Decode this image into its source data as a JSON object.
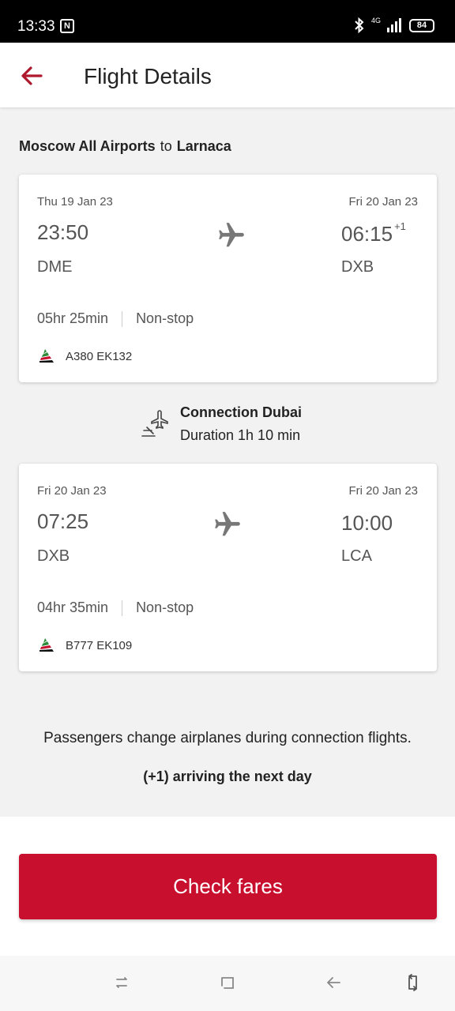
{
  "status": {
    "time": "13:33",
    "nfc": "N",
    "network": "4G",
    "battery": "84"
  },
  "header": {
    "title": "Flight Details"
  },
  "route": {
    "from": "Moscow All Airports",
    "connector": "to",
    "to": "Larnaca"
  },
  "segments": [
    {
      "dep_date": "Thu 19 Jan 23",
      "dep_time": "23:50",
      "dep_code": "DME",
      "arr_date": "Fri 20 Jan 23",
      "arr_time": "06:15",
      "arr_offset": "+1",
      "arr_code": "DXB",
      "duration": "05hr 25min",
      "stops": "Non-stop",
      "flight": "A380 EK132"
    },
    {
      "dep_date": "Fri 20 Jan 23",
      "dep_time": "07:25",
      "dep_code": "DXB",
      "arr_date": "Fri 20 Jan 23",
      "arr_time": "10:00",
      "arr_offset": "",
      "arr_code": "LCA",
      "duration": "04hr 35min",
      "stops": "Non-stop",
      "flight": "B777 EK109"
    }
  ],
  "connection": {
    "title": "Connection Dubai",
    "duration": "Duration 1h 10 min"
  },
  "notes": {
    "change": "Passengers change airplanes during connection flights.",
    "next_day": "(+1) arriving the next day"
  },
  "cta": {
    "label": "Check fares"
  },
  "colors": {
    "accent": "#c8102e",
    "back_arrow": "#b0182e"
  }
}
